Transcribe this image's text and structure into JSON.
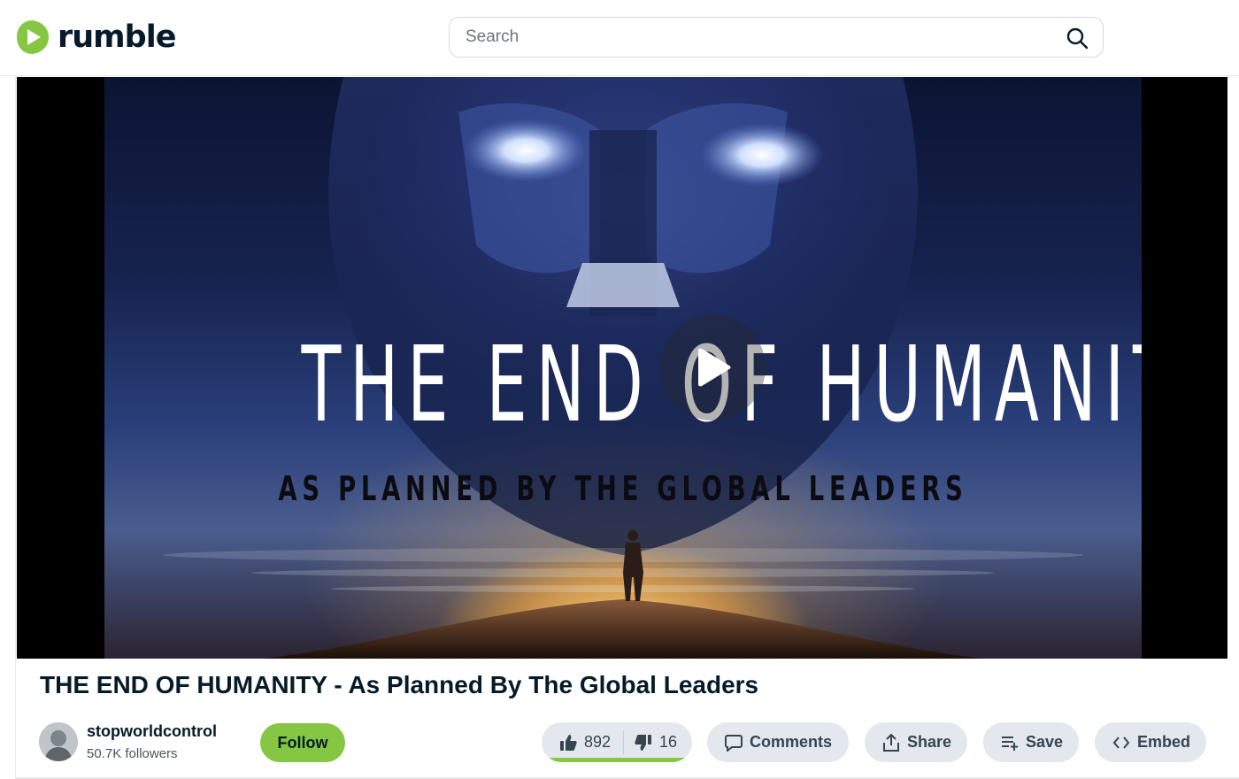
{
  "header": {
    "logo_text": "rumble",
    "logo_icon": "rumble-play-icon",
    "search_placeholder": "Search",
    "search_icon": "search-icon"
  },
  "player": {
    "poster_title": "THE END OF HUMANITY",
    "poster_subtitle": "AS PLANNED BY THE GLOBAL LEADERS",
    "play_icon": "play-icon"
  },
  "video": {
    "title": "THE END OF HUMANITY - As Planned By The Global Leaders"
  },
  "channel": {
    "name": "stopworldcontrol",
    "followers": "50.7K followers",
    "follow_label": "Follow"
  },
  "actions": {
    "likes": "892",
    "dislikes": "16",
    "comments_label": "Comments",
    "share_label": "Share",
    "save_label": "Save",
    "embed_label": "Embed"
  },
  "colors": {
    "brand_green": "#85c742",
    "text_dark": "#061b2a",
    "pill_bg": "#e3e8ee"
  }
}
